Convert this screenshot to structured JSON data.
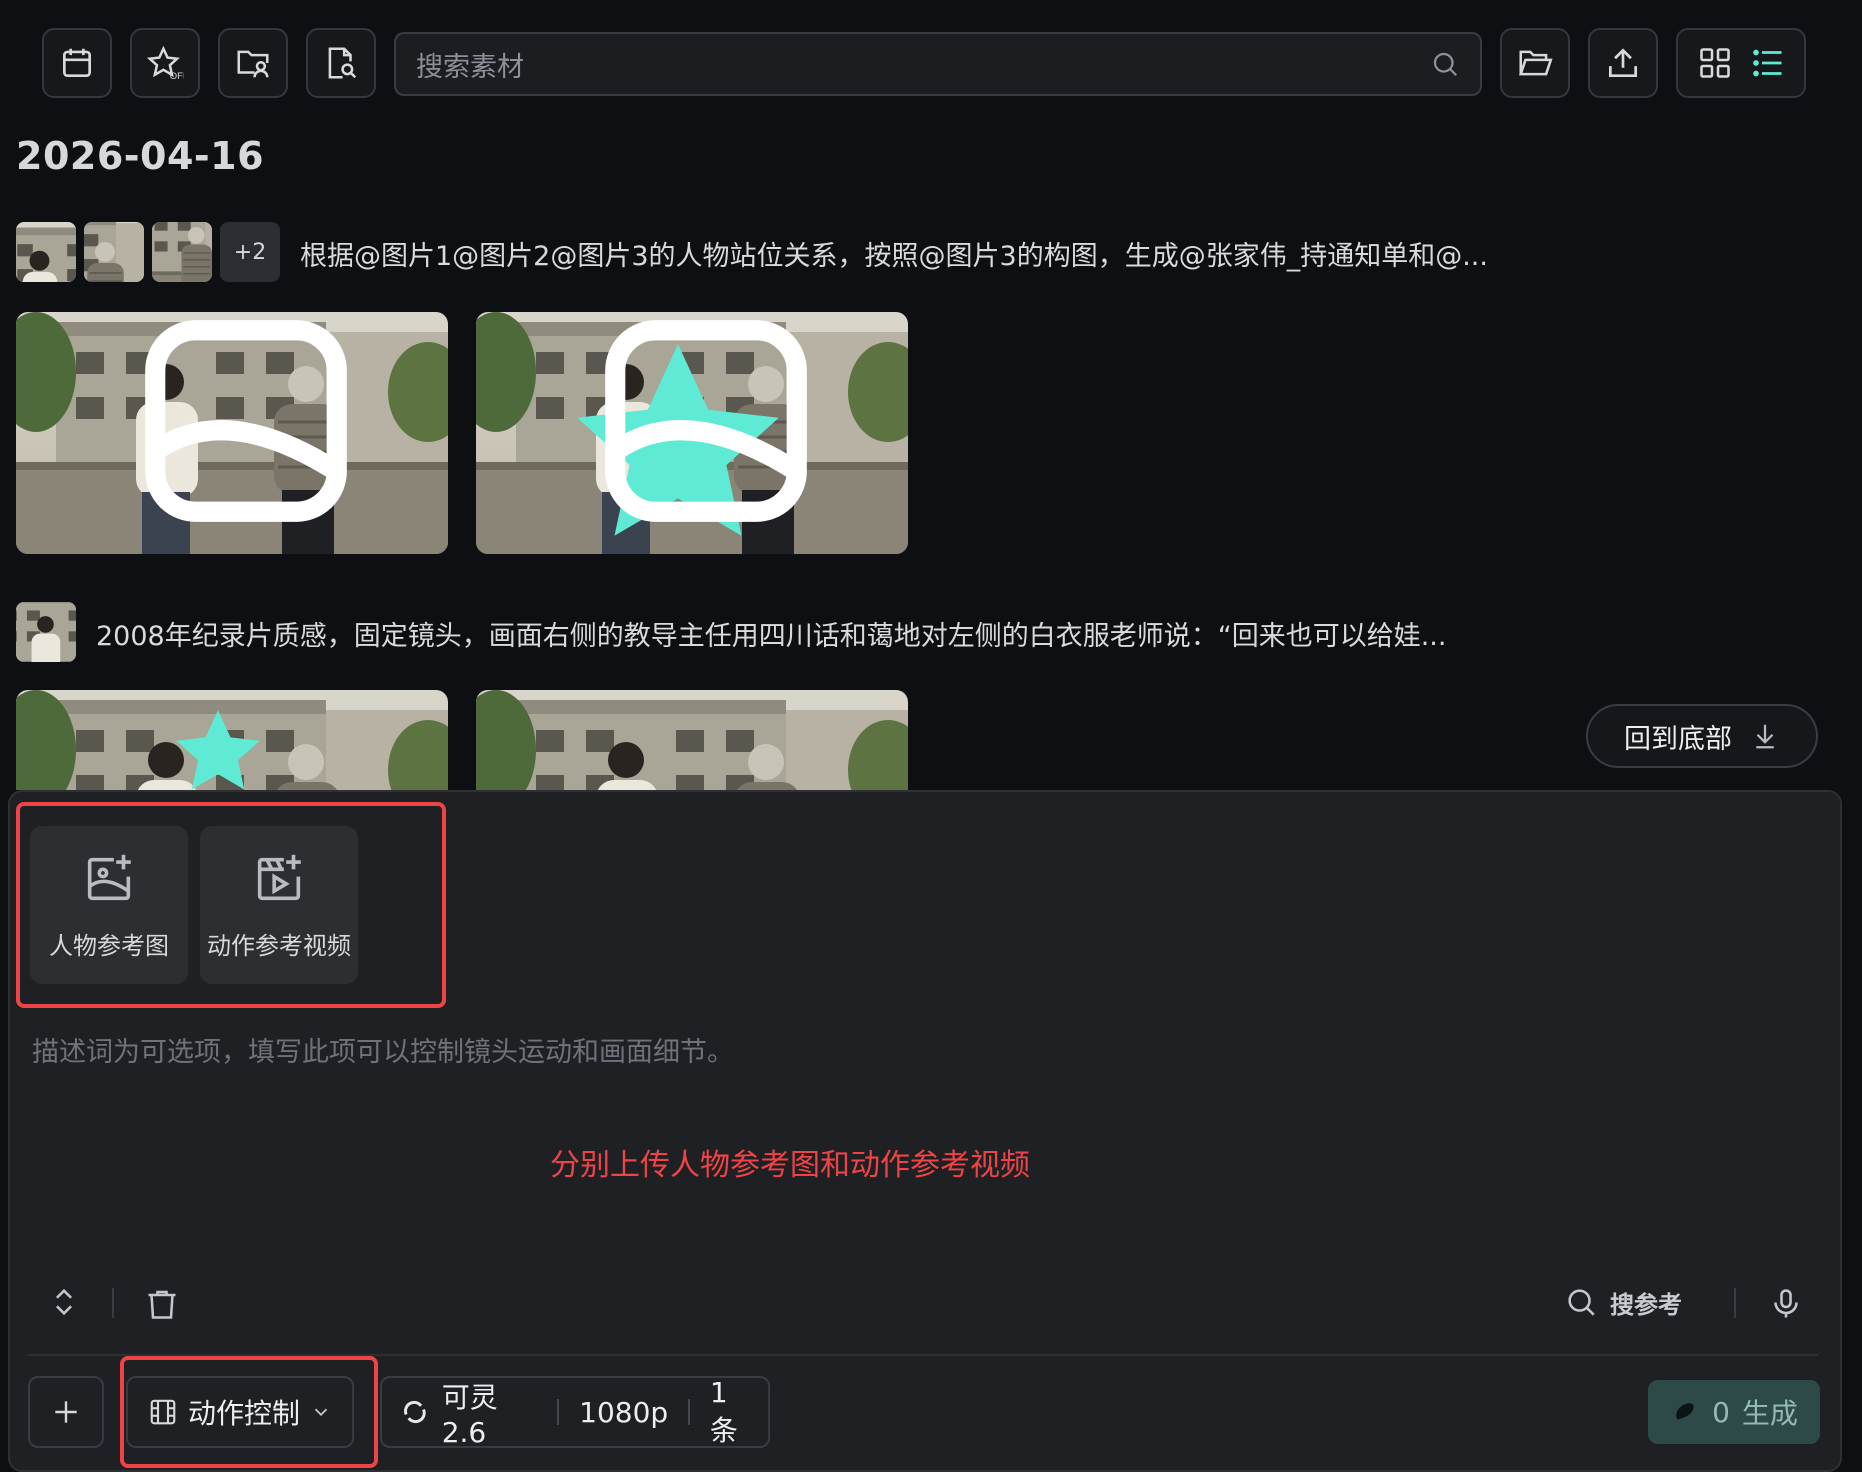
{
  "toolbar": {
    "search_placeholder": "搜索素材",
    "star_badge": "OFF"
  },
  "date_group": "2026-04-16",
  "generations": [
    {
      "more_count": "+2",
      "prompt": "根据@图片1@图片2@图片3的人物站位关系，按照@图片3的构图，生成@张家伟_持通知单和@..."
    },
    {
      "prompt": "2008年纪录片质感，固定镜头，画面右侧的教导主任用四川话和蔼地对左侧的白衣服老师说：“回来也可以给娃..."
    }
  ],
  "back_to_bottom": "回到底部",
  "composer": {
    "upload_person": "人物参考图",
    "upload_motion": "动作参考视频",
    "placeholder": "描述词为可选项，填写此项可以控制镜头运动和画面细节。",
    "annotation": "分别上传人物参考图和动作参考视频",
    "search_ref": "搜参考",
    "mode": "动作控制",
    "model": "可灵 2.6",
    "resolution": "1080p",
    "count": "1条",
    "credits": "0",
    "generate": "生成"
  },
  "colors": {
    "accent_red": "#ef4444",
    "star": "#5eead4",
    "generate_bg": "#2d4a48"
  }
}
